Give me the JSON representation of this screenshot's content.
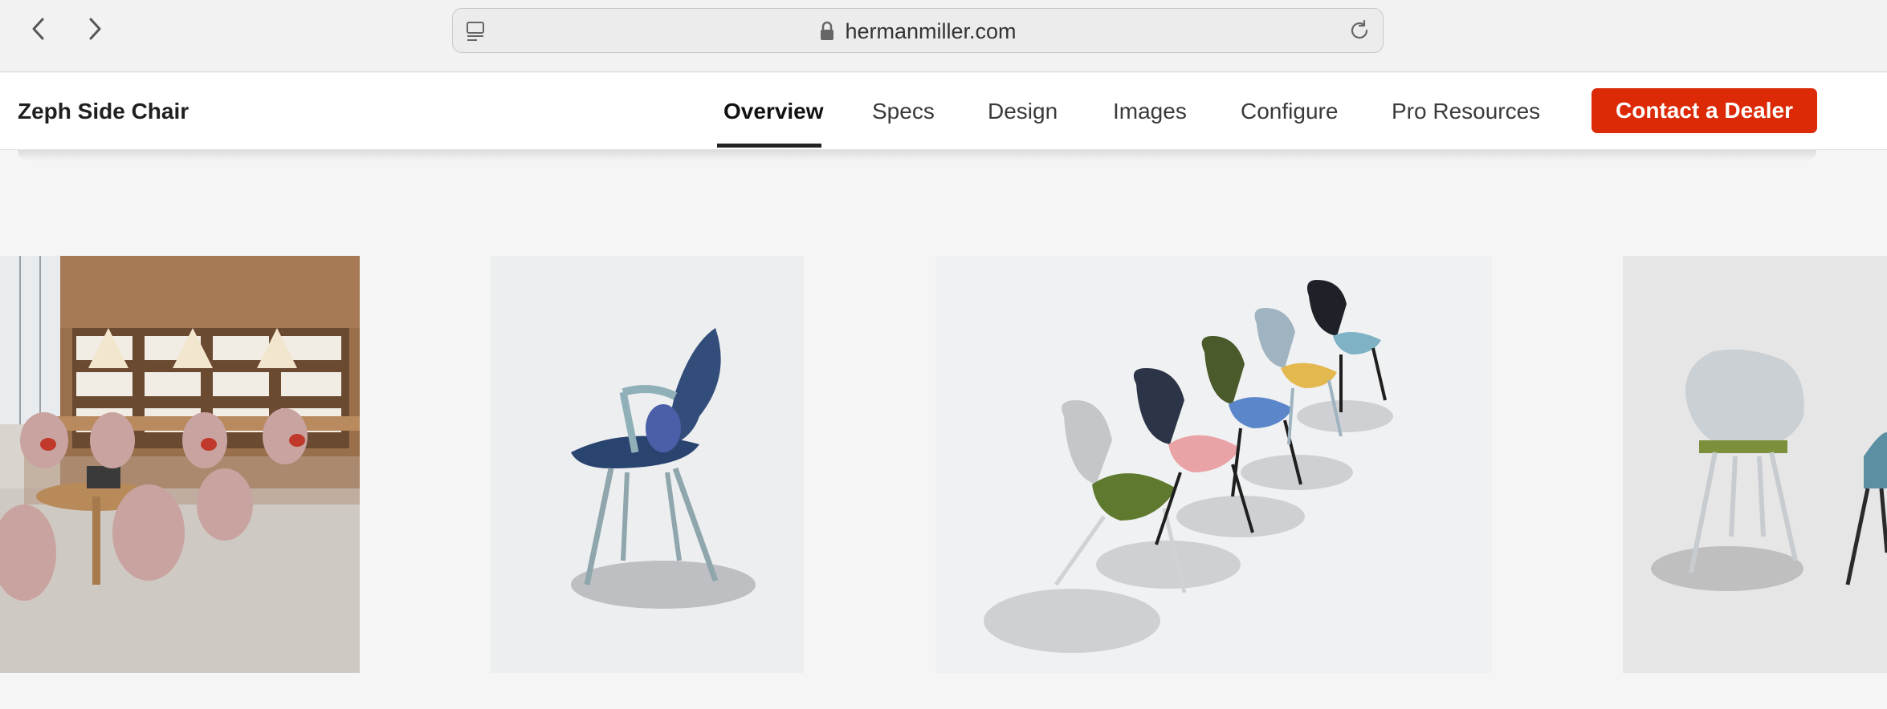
{
  "browser": {
    "url": "hermanmiller.com",
    "back_icon": "chevron-left-icon",
    "forward_icon": "chevron-right-icon",
    "reader_icon": "reader-view-icon",
    "lock_icon": "lock-icon",
    "reload_icon": "reload-icon"
  },
  "header": {
    "product_title": "Zeph Side Chair",
    "nav": [
      {
        "label": "Overview",
        "active": true
      },
      {
        "label": "Specs",
        "active": false
      },
      {
        "label": "Design",
        "active": false
      },
      {
        "label": "Images",
        "active": false
      },
      {
        "label": "Configure",
        "active": false
      },
      {
        "label": "Pro Resources",
        "active": false
      }
    ],
    "cta_label": "Contact a Dealer"
  },
  "colors": {
    "cta": "#dc2a06",
    "page_bg": "#f5f5f5",
    "header_bg": "#ffffff",
    "browser_bg": "#f2f2f2"
  },
  "gallery": [
    {
      "name": "library-scene-image"
    },
    {
      "name": "blue-side-chair-image"
    },
    {
      "name": "chair-lineup-image"
    },
    {
      "name": "gray-chair-pair-image"
    }
  ]
}
